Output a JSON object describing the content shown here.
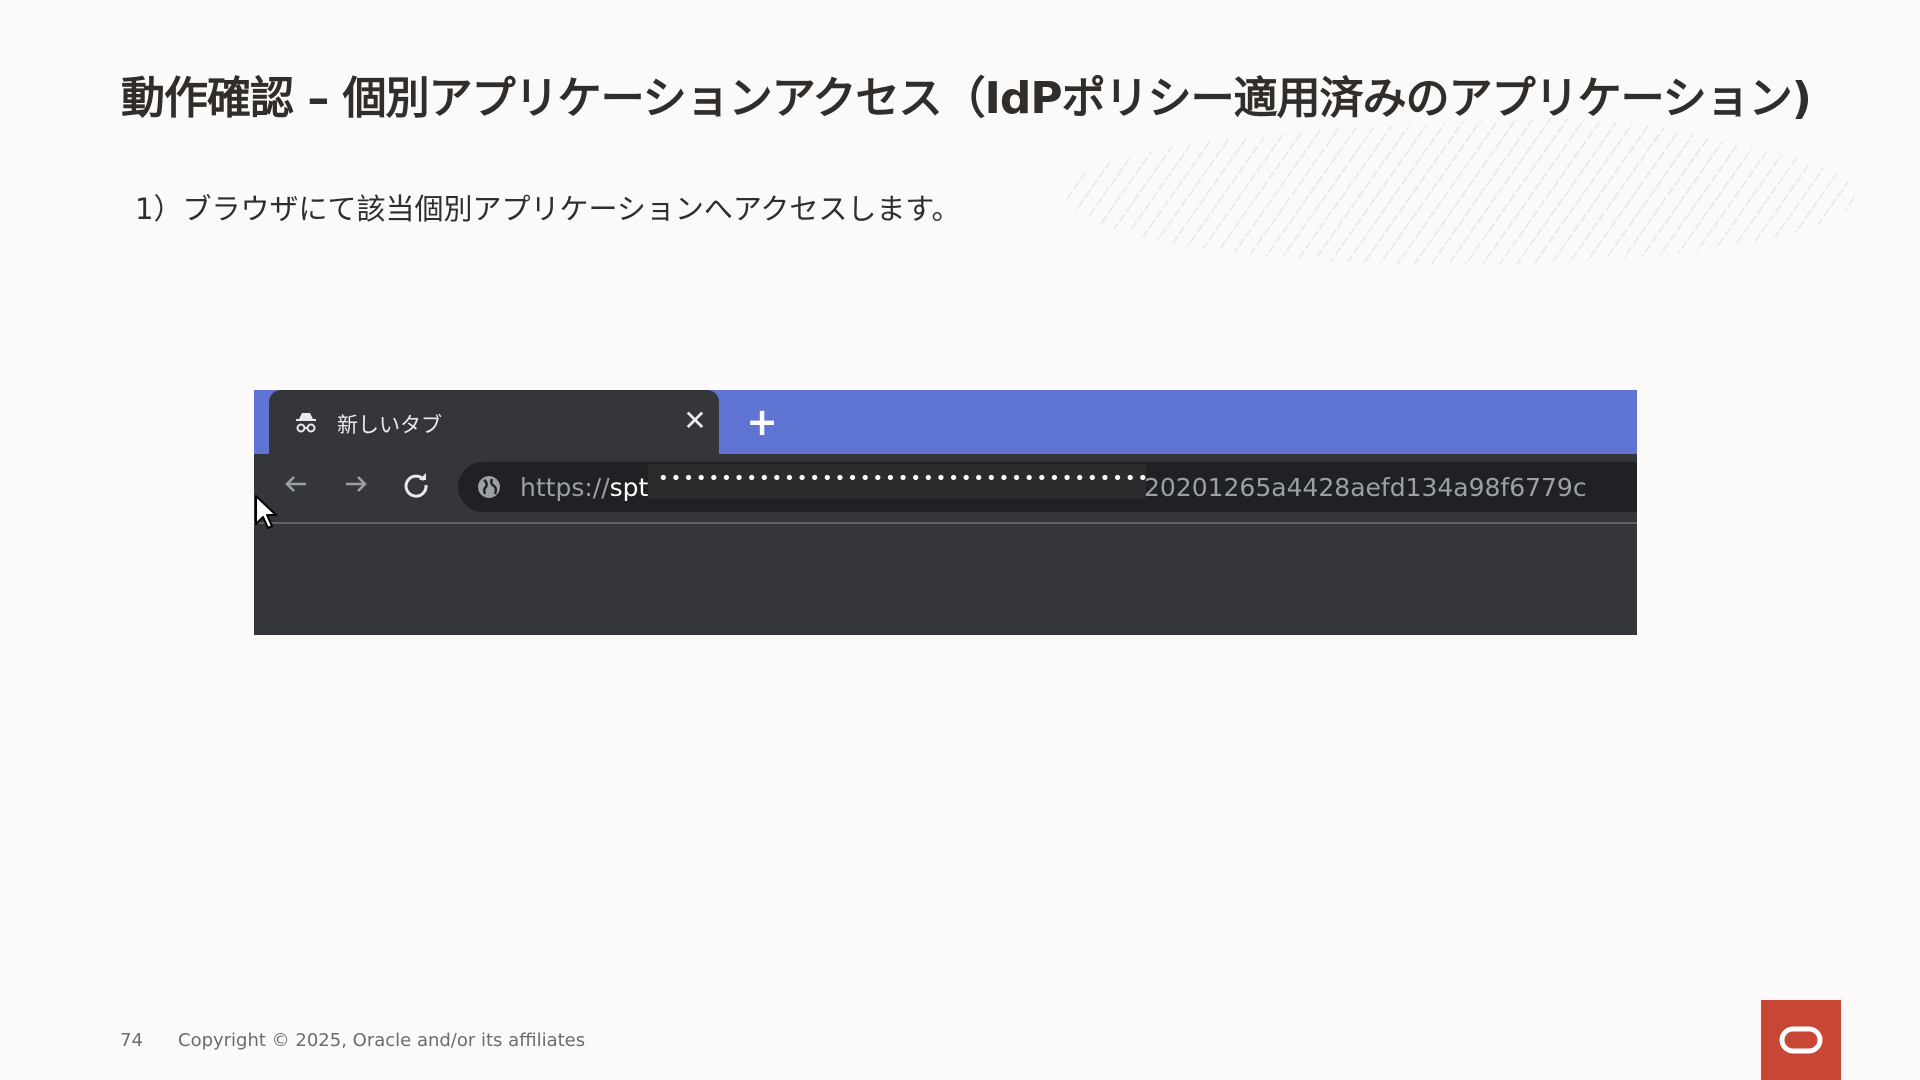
{
  "slide": {
    "title": "動作確認 – 個別アプリケーションアクセス（IdPポリシー適用済みのアプリケーション)",
    "step": "1）ブラウザにて該当個別アプリケーションへアクセスします。"
  },
  "browser": {
    "tab": {
      "icon": "incognito-icon",
      "title": "新しいタブ",
      "close_label": "✕"
    },
    "new_tab_label": "+",
    "url": {
      "prefix": "https://",
      "host_visible": "spt",
      "masked": "••••••••••••••••••••••••••••••••••••••••",
      "suffix": "20201265a4428aefd134a98f6779c"
    },
    "colors": {
      "tabstrip": "#5f74d3",
      "frame": "#35363a",
      "omnibox": "#202124"
    }
  },
  "footer": {
    "page_number": "74",
    "copyright": "Copyright © 2025, Oracle and/or its affiliates"
  },
  "brand": {
    "logo": "oracle-logo",
    "color": "#c74634"
  }
}
